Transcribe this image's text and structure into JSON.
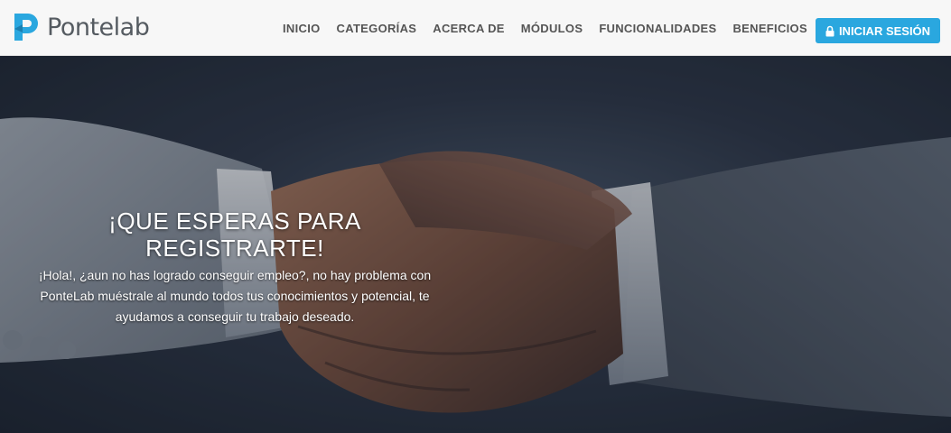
{
  "brand": {
    "name": "Pontelab",
    "logo_icon": "pontelab-logo-icon"
  },
  "nav": {
    "items": [
      {
        "label": "INICIO"
      },
      {
        "label": "CATEGORÍAS"
      },
      {
        "label": "ACERCA DE"
      },
      {
        "label": "MÓDULOS"
      },
      {
        "label": "FUNCIONALIDADES"
      },
      {
        "label": "BENEFICIOS"
      }
    ],
    "login": {
      "label": "INICIAR SESIÓN",
      "icon": "lock-icon"
    }
  },
  "hero": {
    "title": "¡QUE ESPERAS PARA REGISTRARTE!",
    "body": "¡Hola!, ¿aun no has logrado conseguir empleo?, no hay problema con PonteLab muéstrale al mundo todos tus conocimientos y potencial, te ayudamos a conseguir tu trabajo deseado.",
    "background_image": "handshake-photo"
  },
  "colors": {
    "accent": "#2aa7df",
    "nav_text": "#555555",
    "nav_bg": "#f7f7f7"
  }
}
